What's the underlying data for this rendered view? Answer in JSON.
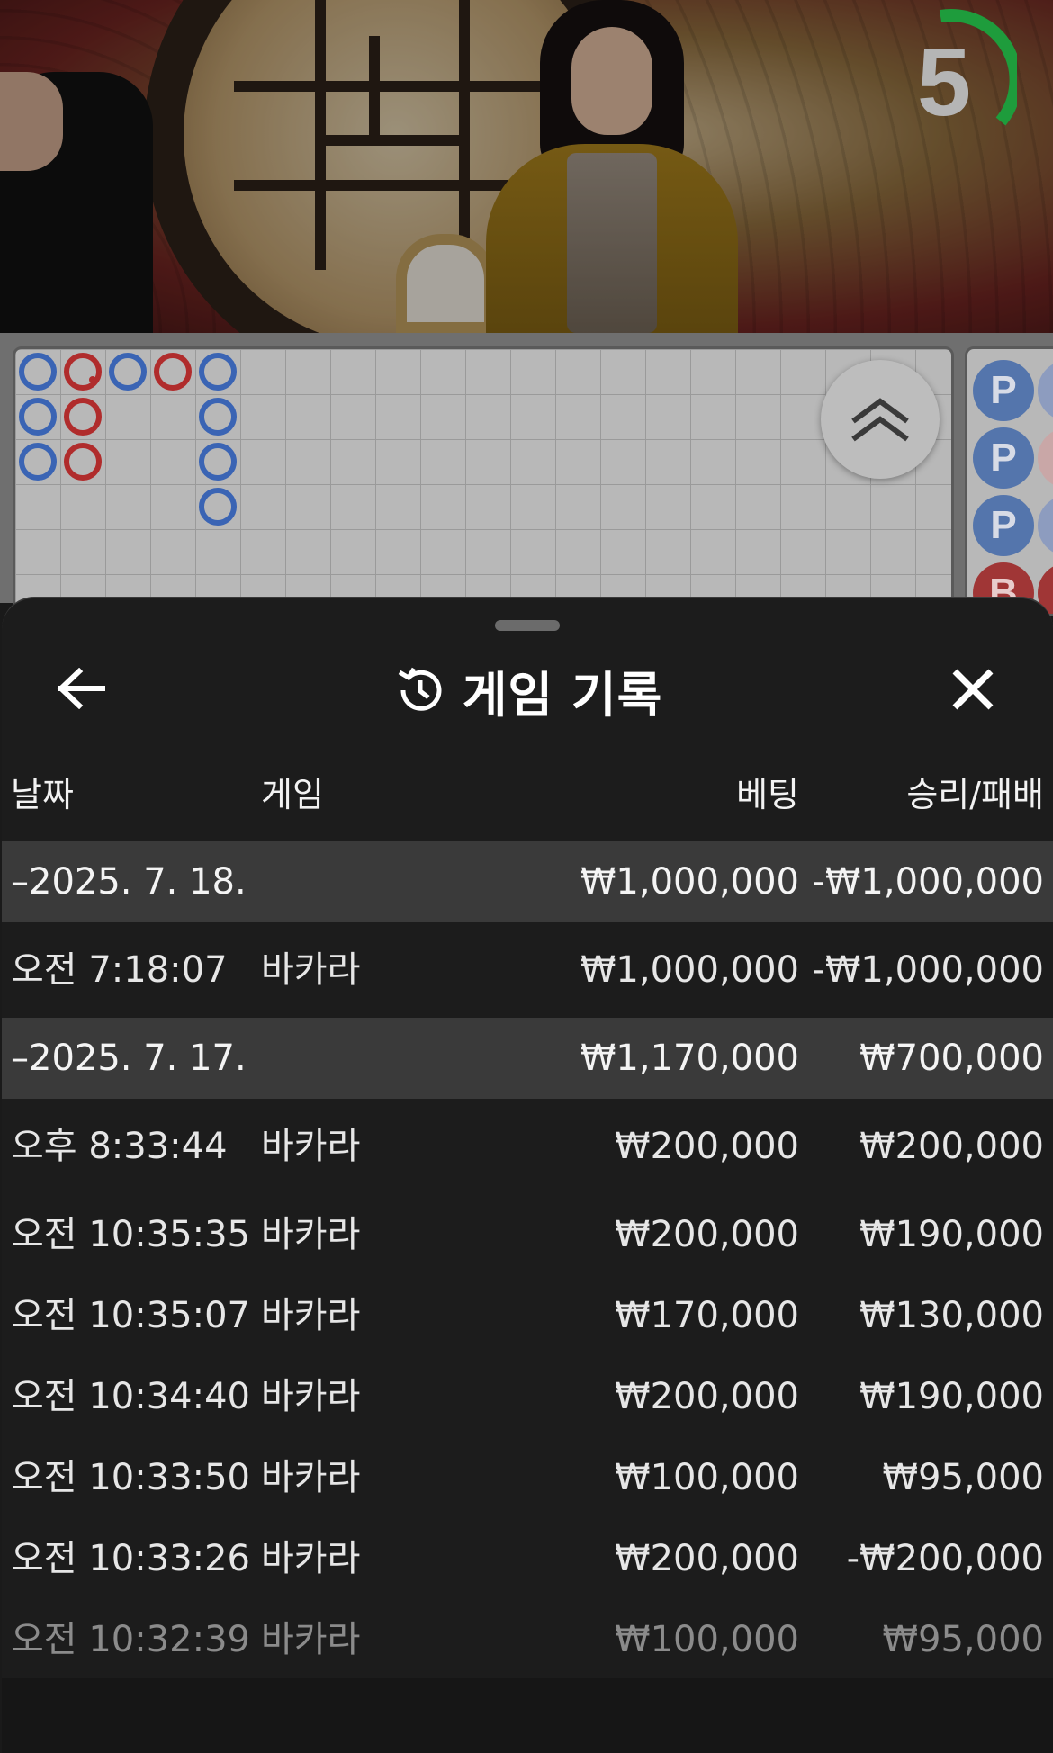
{
  "video": {
    "timer": "5",
    "timer_color": "#1e9c3c"
  },
  "roadmap": {
    "bead_road_pattern": [
      [
        "P",
        "B",
        "P",
        "B",
        "P"
      ],
      [
        "P",
        "B",
        "",
        "",
        "P"
      ],
      [
        "P",
        "B",
        "",
        "",
        "P"
      ],
      [
        "",
        "",
        "",
        "",
        "P"
      ]
    ],
    "side_road": [
      "P",
      "P",
      "P",
      "B"
    ],
    "expand_icon": "double-chevron-up-icon",
    "colors": {
      "player": "#3a64b4",
      "banker": "#b02c2c"
    }
  },
  "history": {
    "title": "게임 기록",
    "back_icon": "arrow-left-icon",
    "history_icon": "history-icon",
    "close_icon": "close-icon",
    "columns": {
      "date": "날짜",
      "game": "게임",
      "bet": "베팅",
      "winloss": "승리/패배"
    },
    "groups": [
      {
        "date": "–2025. 7. 18.",
        "bet": "₩1,000,000",
        "winloss": "-₩1,000,000",
        "rows": [
          {
            "time": "오전 7:18:07",
            "game": "바카라",
            "bet": "₩1,000,000",
            "winloss": "-₩1,000,000"
          }
        ]
      },
      {
        "date": "–2025. 7. 17.",
        "bet": "₩1,170,000",
        "winloss": "₩700,000",
        "rows": [
          {
            "time": "오후 8:33:44",
            "game": "바카라",
            "bet": "₩200,000",
            "winloss": "₩200,000"
          },
          {
            "time": "오전 10:35:35",
            "game": "바카라",
            "bet": "₩200,000",
            "winloss": "₩190,000"
          },
          {
            "time": "오전 10:35:07",
            "game": "바카라",
            "bet": "₩170,000",
            "winloss": "₩130,000"
          },
          {
            "time": "오전 10:34:40",
            "game": "바카라",
            "bet": "₩200,000",
            "winloss": "₩190,000"
          },
          {
            "time": "오전 10:33:50",
            "game": "바카라",
            "bet": "₩100,000",
            "winloss": "₩95,000"
          },
          {
            "time": "오전 10:33:26",
            "game": "바카라",
            "bet": "₩200,000",
            "winloss": "-₩200,000"
          },
          {
            "time": "오전 10:32:39",
            "game": "바카라",
            "bet": "₩100,000",
            "winloss": "₩95,000"
          }
        ]
      }
    ]
  }
}
